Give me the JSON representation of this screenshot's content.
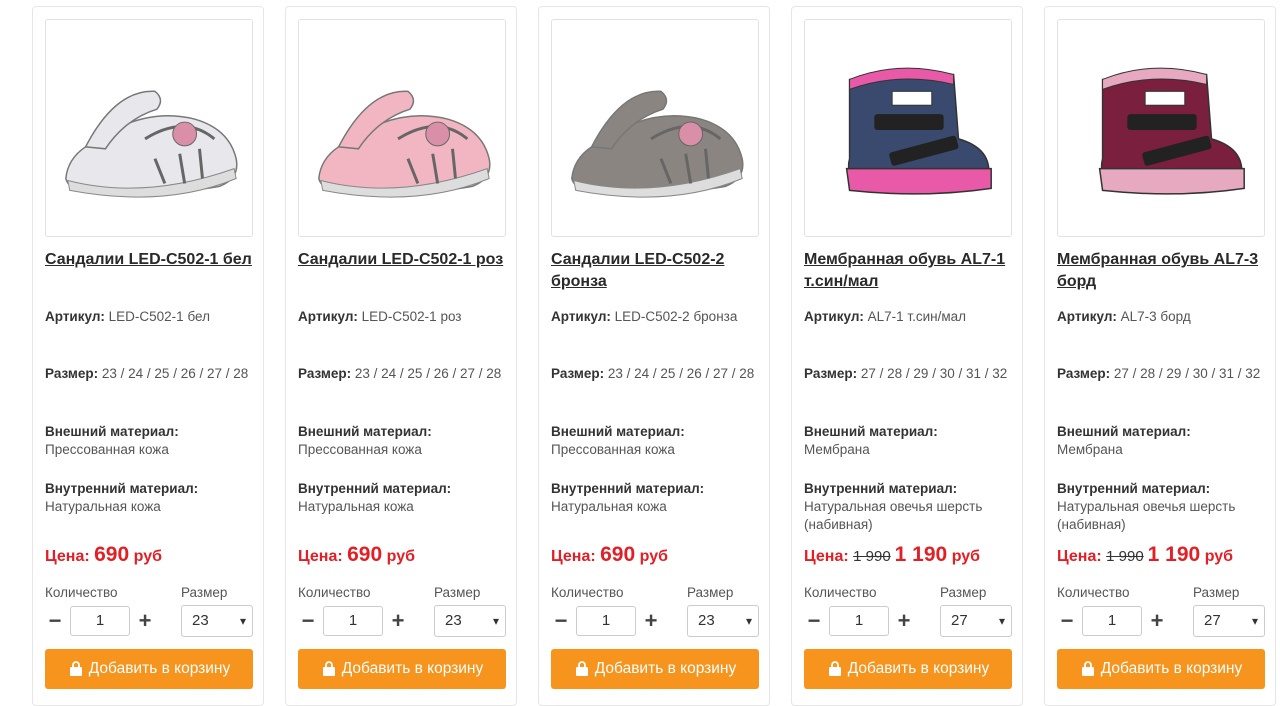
{
  "products": [
    {
      "title": "Сандалии LED-C502-1 бел",
      "article_label": "Артикул:",
      "article": "LED-C502-1 бел",
      "size_label": "Размер:",
      "sizes": "23 / 24 / 25 / 26 / 27 / 28",
      "outer_label": "Внешний материал:",
      "outer": "Прессованная кожа",
      "inner_label": "Внутренний материал:",
      "inner": "Натуральная кожа",
      "price_label": "Цена:",
      "old_price": "",
      "price": "690",
      "currency": "руб",
      "qty_label": "Количество",
      "qty_value": "1",
      "size_select_label": "Размер",
      "size_value": "23",
      "cart_label": "Добавить в корзину",
      "image": {
        "kind": "sandal",
        "color": "#e8e8ec"
      }
    },
    {
      "title": "Сандалии LED-C502-1 роз",
      "article_label": "Артикул:",
      "article": "LED-C502-1 роз",
      "size_label": "Размер:",
      "sizes": "23 / 24 / 25 / 26 / 27 / 28",
      "outer_label": "Внешний материал:",
      "outer": "Прессованная кожа",
      "inner_label": "Внутренний материал:",
      "inner": "Натуральная кожа",
      "price_label": "Цена:",
      "old_price": "",
      "price": "690",
      "currency": "руб",
      "qty_label": "Количество",
      "qty_value": "1",
      "size_select_label": "Размер",
      "size_value": "23",
      "cart_label": "Добавить в корзину",
      "image": {
        "kind": "sandal",
        "color": "#f2b6c3"
      }
    },
    {
      "title": "Сандалии LED-C502-2 бронза",
      "article_label": "Артикул:",
      "article": "LED-C502-2 бронза",
      "size_label": "Размер:",
      "sizes": "23 / 24 / 25 / 26 / 27 / 28",
      "outer_label": "Внешний материал:",
      "outer": "Прессованная кожа",
      "inner_label": "Внутренний материал:",
      "inner": "Натуральная кожа",
      "price_label": "Цена:",
      "old_price": "",
      "price": "690",
      "currency": "руб",
      "qty_label": "Количество",
      "qty_value": "1",
      "size_select_label": "Размер",
      "size_value": "23",
      "cart_label": "Добавить в корзину",
      "image": {
        "kind": "sandal",
        "color": "#8a8580"
      }
    },
    {
      "title": "Мембранная обувь AL7-1 т.син/мал",
      "article_label": "Артикул:",
      "article": "AL7-1 т.син/мал",
      "size_label": "Размер:",
      "sizes": "27 / 28 / 29 / 30 / 31 / 32",
      "outer_label": "Внешний материал:",
      "outer": "Мембрана",
      "inner_label": "Внутренний материал:",
      "inner": "Натуральная овечья шерсть (набивная)",
      "price_label": "Цена:",
      "old_price": "1 990",
      "price": "1 190",
      "currency": "руб",
      "qty_label": "Количество",
      "qty_value": "1",
      "size_select_label": "Размер",
      "size_value": "27",
      "cart_label": "Добавить в корзину",
      "image": {
        "kind": "boot",
        "color": "#3a4a6e",
        "accent": "#e85aa8"
      }
    },
    {
      "title": "Мембранная обувь AL7-3 борд",
      "article_label": "Артикул:",
      "article": "AL7-3 борд",
      "size_label": "Размер:",
      "sizes": "27 / 28 / 29 / 30 / 31 / 32",
      "outer_label": "Внешний материал:",
      "outer": "Мембрана",
      "inner_label": "Внутренний материал:",
      "inner": "Натуральная овечья шерсть (набивная)",
      "price_label": "Цена:",
      "old_price": "1 990",
      "price": "1 190",
      "currency": "руб",
      "qty_label": "Количество",
      "qty_value": "1",
      "size_select_label": "Размер",
      "size_value": "27",
      "cart_label": "Добавить в корзину",
      "image": {
        "kind": "boot",
        "color": "#7a1f3d",
        "accent": "#e6a9c0"
      }
    }
  ],
  "icons": {
    "minus": "−",
    "plus": "+",
    "chevron": "▾",
    "bag": "shopping-bag-icon"
  },
  "colors": {
    "price": "#e31e24",
    "button": "#f7941d",
    "border": "#e6e6e6"
  }
}
